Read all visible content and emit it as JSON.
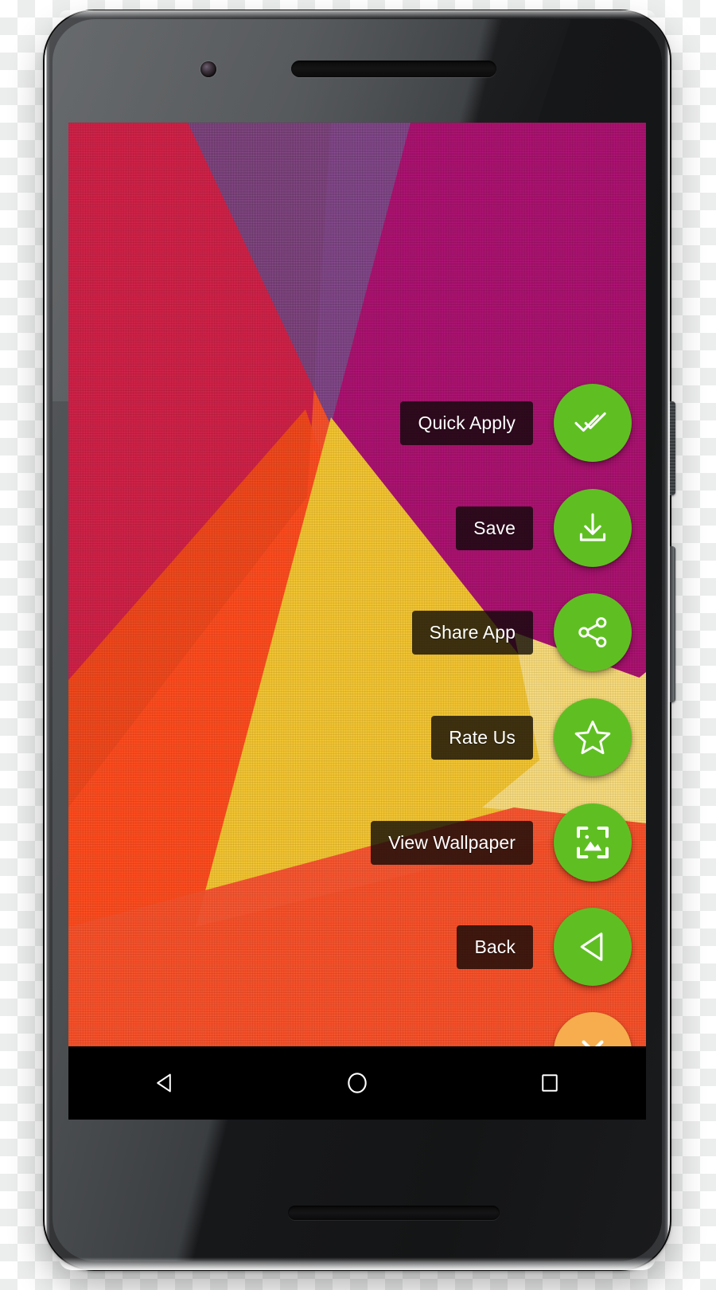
{
  "device": {
    "name": "android-smartphone",
    "camera": "front-camera-icon",
    "earpiece": "earpiece-speaker-icon",
    "bottom_speaker": "bottom-speaker-grille-icon",
    "power_key": "power-button",
    "volume_key": "volume-rocker-button"
  },
  "app": {
    "name": "wallpaper-app",
    "fab_color": "#5fbf22",
    "close_fab_color": "#f7ad4d",
    "label_bg": "rgba(12,8,6,0.78)",
    "label_text_color": "#ffffff"
  },
  "wallpaper": {
    "name": "nexus-fabric-wallpaper",
    "colors": {
      "crimson": "#d7234b",
      "violet": "#7a4a86",
      "magenta": "#a8126e",
      "orange_bright": "#fa4b1e",
      "yellow": "#f0c12b",
      "cream": "#f5d878",
      "orange_base": "#f4502a"
    }
  },
  "menu": {
    "items": [
      {
        "label": "Quick Apply",
        "icon": "done-all-icon",
        "color": "#5fbf22"
      },
      {
        "label": "Save",
        "icon": "download-icon",
        "color": "#5fbf22"
      },
      {
        "label": "Share App",
        "icon": "share-icon",
        "color": "#5fbf22"
      },
      {
        "label": "Rate Us",
        "icon": "star-outline-icon",
        "color": "#5fbf22"
      },
      {
        "label": "View Wallpaper",
        "icon": "crop-image-icon",
        "color": "#5fbf22"
      },
      {
        "label": "Back",
        "icon": "play-back-icon",
        "color": "#5fbf22"
      }
    ],
    "close": {
      "label": "",
      "icon": "close-icon",
      "color": "#f7ad4d"
    }
  },
  "navbar": {
    "background": "#000000",
    "buttons": [
      {
        "name": "nav-back-button",
        "icon": "triangle-left-icon"
      },
      {
        "name": "nav-home-button",
        "icon": "circle-icon"
      },
      {
        "name": "nav-recents-button",
        "icon": "square-icon"
      }
    ]
  }
}
